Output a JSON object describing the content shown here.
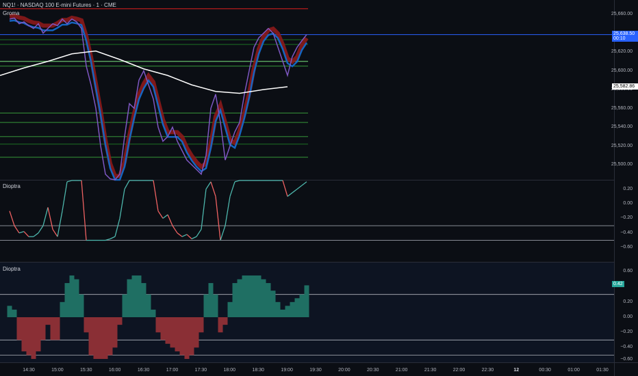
{
  "header": {
    "symbol_title": "NQ1! · NASDAQ 100 E-mini Futures · 1 · CME",
    "indicator_main": "Groma"
  },
  "panes": [
    {
      "title": "Dioptra"
    },
    {
      "title": "Dioptra"
    }
  ],
  "badges": {
    "last_price": "25,638.50",
    "countdown": "00:10",
    "ma_value": "25,582.86",
    "osc2_value": "0.42"
  },
  "colors": {
    "bg": "#0b0e14",
    "price_line": "#2962ff",
    "bull": "#26a69a",
    "bear": "#ef5350",
    "ma": "#ffffff"
  },
  "chart_data": {
    "type": "line",
    "title": "NQ1! · NASDAQ 100 E-mini Futures · 1 · CME",
    "x_start": "14:10",
    "x_step_minutes": 5,
    "price": [
      25655,
      25656,
      25650,
      25652,
      25648,
      25645,
      25650,
      25640,
      25645,
      25650,
      25648,
      25655,
      25650,
      25655,
      25652,
      25645,
      25605,
      25585,
      25560,
      25520,
      25490,
      25485,
      25480,
      25490,
      25530,
      25565,
      25560,
      25590,
      25600,
      25585,
      25570,
      25540,
      25525,
      25530,
      25540,
      25525,
      25515,
      25505,
      25500,
      25495,
      25490,
      25510,
      25560,
      25575,
      25545,
      25505,
      25520,
      25535,
      25545,
      25575,
      25600,
      25625,
      25635,
      25640,
      25645,
      25640,
      25625,
      25610,
      25595,
      25615,
      25625,
      25632,
      25638.5
    ],
    "ma_step5": [
      25595,
      25603,
      25610,
      25618,
      25621,
      25612,
      25602,
      25595,
      25585,
      25578,
      25576,
      25580,
      25583
    ],
    "osc1": [
      -0.1,
      -0.3,
      -0.4,
      -0.38,
      -0.45,
      -0.45,
      -0.4,
      -0.3,
      -0.05,
      -0.35,
      -0.45,
      -0.1,
      0.3,
      0.4,
      0.4,
      0.35,
      -0.5,
      -0.5,
      -0.5,
      -0.5,
      -0.5,
      -0.48,
      -0.45,
      -0.2,
      0.2,
      0.35,
      0.4,
      0.4,
      0.4,
      0.4,
      0.35,
      -0.1,
      -0.2,
      -0.15,
      -0.3,
      -0.4,
      -0.45,
      -0.42,
      -0.48,
      -0.45,
      -0.35,
      0.2,
      0.3,
      0.1,
      -0.5,
      -0.3,
      0.1,
      0.3,
      0.4,
      0.4,
      0.4,
      0.4,
      0.4,
      0.4,
      0.4,
      0.4,
      0.4,
      0.4,
      0.1,
      0.15,
      0.2,
      0.25,
      0.3
    ],
    "osc2": [
      0.15,
      0.1,
      -0.3,
      -0.45,
      -0.5,
      -0.55,
      -0.45,
      -0.3,
      -0.1,
      -0.3,
      -0.3,
      0.2,
      0.45,
      0.55,
      0.5,
      0.3,
      -0.2,
      -0.5,
      -0.55,
      -0.55,
      -0.55,
      -0.5,
      -0.4,
      -0.1,
      0.3,
      0.5,
      0.55,
      0.55,
      0.45,
      0.3,
      0.1,
      -0.2,
      -0.3,
      -0.35,
      -0.4,
      -0.45,
      -0.5,
      -0.55,
      -0.5,
      -0.4,
      -0.2,
      0.3,
      0.45,
      0.3,
      -0.2,
      -0.1,
      0.2,
      0.45,
      0.5,
      0.55,
      0.55,
      0.55,
      0.55,
      0.5,
      0.45,
      0.35,
      0.2,
      0.1,
      0.15,
      0.2,
      0.25,
      0.3,
      0.42
    ],
    "levels": [
      {
        "value": 25666,
        "color": "#b71c1c"
      },
      {
        "value": 25633,
        "color": "#1b5e20"
      },
      {
        "value": 25628,
        "color": "#1b5e20"
      },
      {
        "value": 25610,
        "color": "#66bb6a"
      },
      {
        "value": 25605,
        "color": "#2e7d32"
      },
      {
        "value": 25555,
        "color": "#2e7d32"
      },
      {
        "value": 25545,
        "color": "#2e7d32"
      },
      {
        "value": 25530,
        "color": "#2e7d32"
      },
      {
        "value": 25522,
        "color": "#1b5e20"
      },
      {
        "value": 25508,
        "color": "#2e7d32"
      }
    ],
    "price_ticks": [
      "25,660.00",
      "25,620.00",
      "25,600.00",
      "25,580.00",
      "25,560.00",
      "25,540.00",
      "25,520.00",
      "25,500.00"
    ],
    "price_tick_values": [
      25660,
      25620,
      25600,
      25580,
      25560,
      25540,
      25520,
      25500
    ],
    "osc1_ticks": [
      "0.20",
      "0.00",
      "−0.20",
      "−0.40",
      "−0.60"
    ],
    "osc2_ticks": [
      "0.60",
      "0.20",
      "0.00",
      "−0.20",
      "−0.40",
      "−0.60"
    ],
    "osc1_levels": [
      -0.3,
      -0.5
    ],
    "osc2_levels": [
      0.3,
      -0.3,
      -0.5
    ],
    "time_ticks": [
      "14:30",
      "15:00",
      "15:30",
      "16:00",
      "16:30",
      "17:00",
      "17:30",
      "18:00",
      "18:30",
      "19:00",
      "19:30",
      "20:00",
      "20:30",
      "21:00",
      "21:30",
      "22:00",
      "22:30",
      "12",
      "00:30",
      "01:00",
      "01:30"
    ]
  }
}
